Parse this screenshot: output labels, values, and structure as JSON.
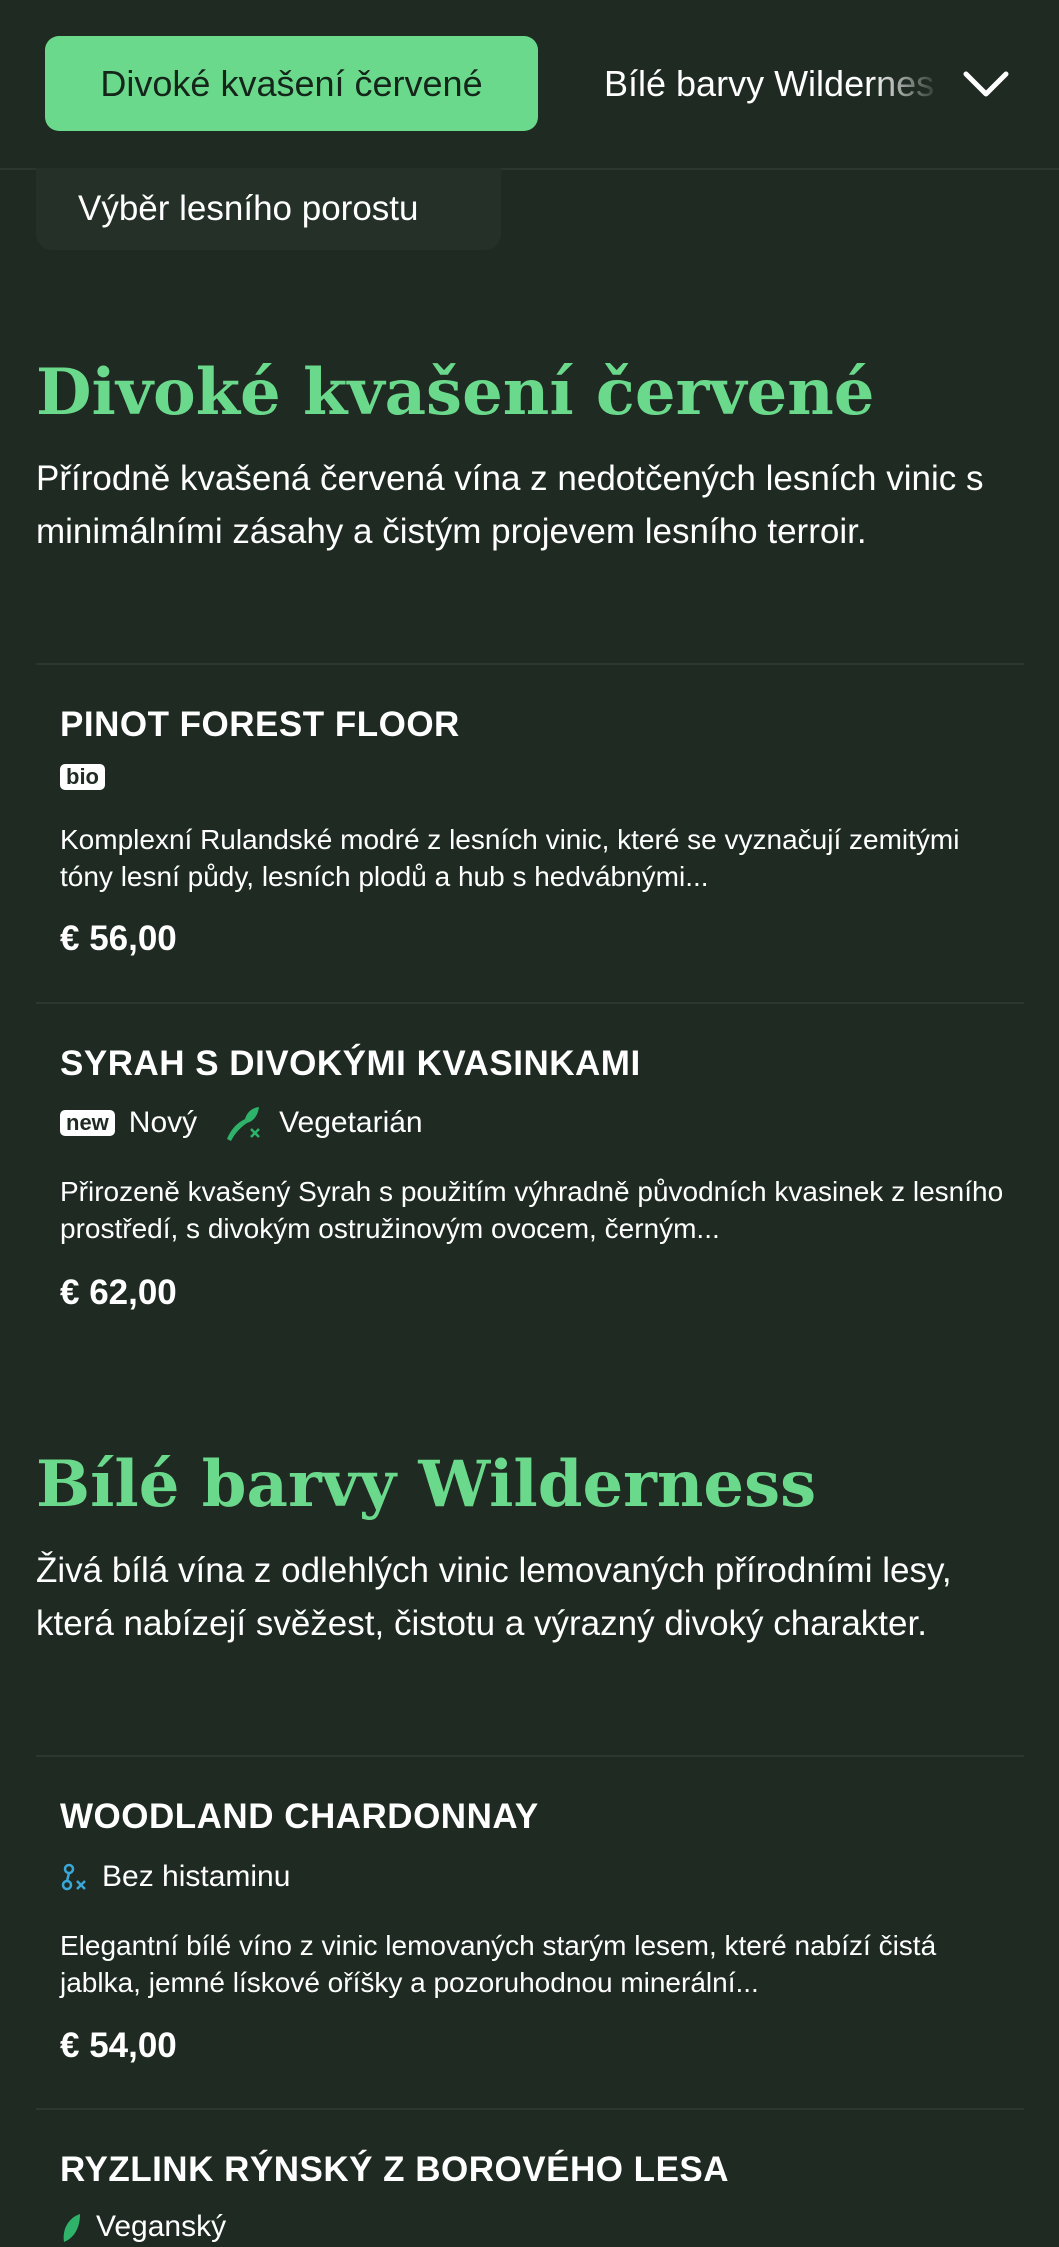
{
  "nav": {
    "active_tab": "Divoké kvašení červené",
    "next_tab": "Bílé barvy Wilderness",
    "sub_tab": "Výběr lesního porostu"
  },
  "sections": [
    {
      "title": "Divoké kvašení červené",
      "description": "Přírodně kvašená červená vína z nedotčených lesních vinic s minimálními zásahy a čistým projevem lesního terroir.",
      "items": [
        {
          "name": "PINOT FOREST FLOOR",
          "badge": "bio",
          "description": "Komplexní Rulandské modré z lesních vinic, které se vyznačují zemitými tóny lesní půdy, lesních plodů a hub s hedvábnými...",
          "price": "€ 56,00"
        },
        {
          "name": "SYRAH S DIVOKÝMI KVASINKAMI",
          "badge": "new",
          "badge_label": "Nový",
          "diet_label": "Vegetarián",
          "description": "Přirozeně kvašený Syrah s použitím výhradně původních kvasinek z lesního prostředí, s divokým ostružinovým ovocem, černým...",
          "price": "€ 62,00"
        }
      ]
    },
    {
      "title": "Bílé barvy Wilderness",
      "description": "Živá bílá vína z odlehlých vinic lemovaných přírodními lesy, která nabízejí svěžest, čistotu a výrazný divoký charakter.",
      "items": [
        {
          "name": "WOODLAND CHARDONNAY",
          "diet_label": "Bez histaminu",
          "description": "Elegantní bílé víno z vinic lemovaných starým lesem, které nabízí čistá jablka, jemné lískové oříšky a pozoruhodnou minerální...",
          "price": "€ 54,00"
        },
        {
          "name": "RYZLINK RÝNSKÝ Z BOROVÉHO LESA",
          "diet_label": "Veganský"
        }
      ]
    }
  ],
  "colors": {
    "background": "#1e2a22",
    "accent": "#6bd98b",
    "vegetarian_icon": "#2fb36a",
    "histamine_icon": "#3aa8d8",
    "vegan_icon": "#2fb36a"
  },
  "icons": {
    "chevron": "chevron-down-icon",
    "vegetarian": "vegetarian-icon",
    "histamine": "histamine-free-icon",
    "vegan": "vegan-leaf-icon"
  }
}
